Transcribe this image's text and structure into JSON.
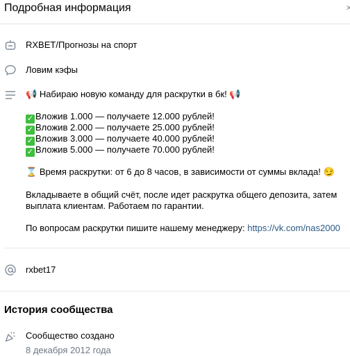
{
  "header": {
    "title": "Подробная информация",
    "close_glyph": "×"
  },
  "info_rows": {
    "name": "RXBET/Прогнозы на спорт",
    "status": "Ловим кэфы"
  },
  "description": {
    "headline_emoji": "📢",
    "headline": "Набираю новую команду для раскрутки в бк!",
    "offers": [
      "Вложив 1.000 — получаете 12.000 рублей!",
      "Вложив 2.000 — получаете 25.000 рублей!",
      "Вложив 3.000 — получаете 40.000 рублей!",
      "Вложив 5.000 — получаете 70.000 рублей!"
    ],
    "check_glyph": "✓",
    "time_emoji": "⌛",
    "time_text": "Время раскрутки: от 6 до 8 часов, в зависимости от суммы вклада!",
    "smile_emoji": "😏",
    "process_line1": "Вкладываете в общий счёт, после идет раскрутка общего депозита, затем",
    "process_line2": "выплата клиентам. Работаем по гарантии.",
    "contact_text": "По вопросам раскрутки пишите нашему менеджеру: ",
    "contact_link": "https://vk.com/nas2000"
  },
  "short_address": "rxbet17",
  "history": {
    "title": "История сообщества",
    "event_label": "Сообщество создано",
    "event_date": "8 декабря 2012 года"
  },
  "colors": {
    "accent": "#2a5885",
    "icon": "#818c99",
    "divider": "#e4e7eb",
    "check": "#3fbe3f"
  }
}
